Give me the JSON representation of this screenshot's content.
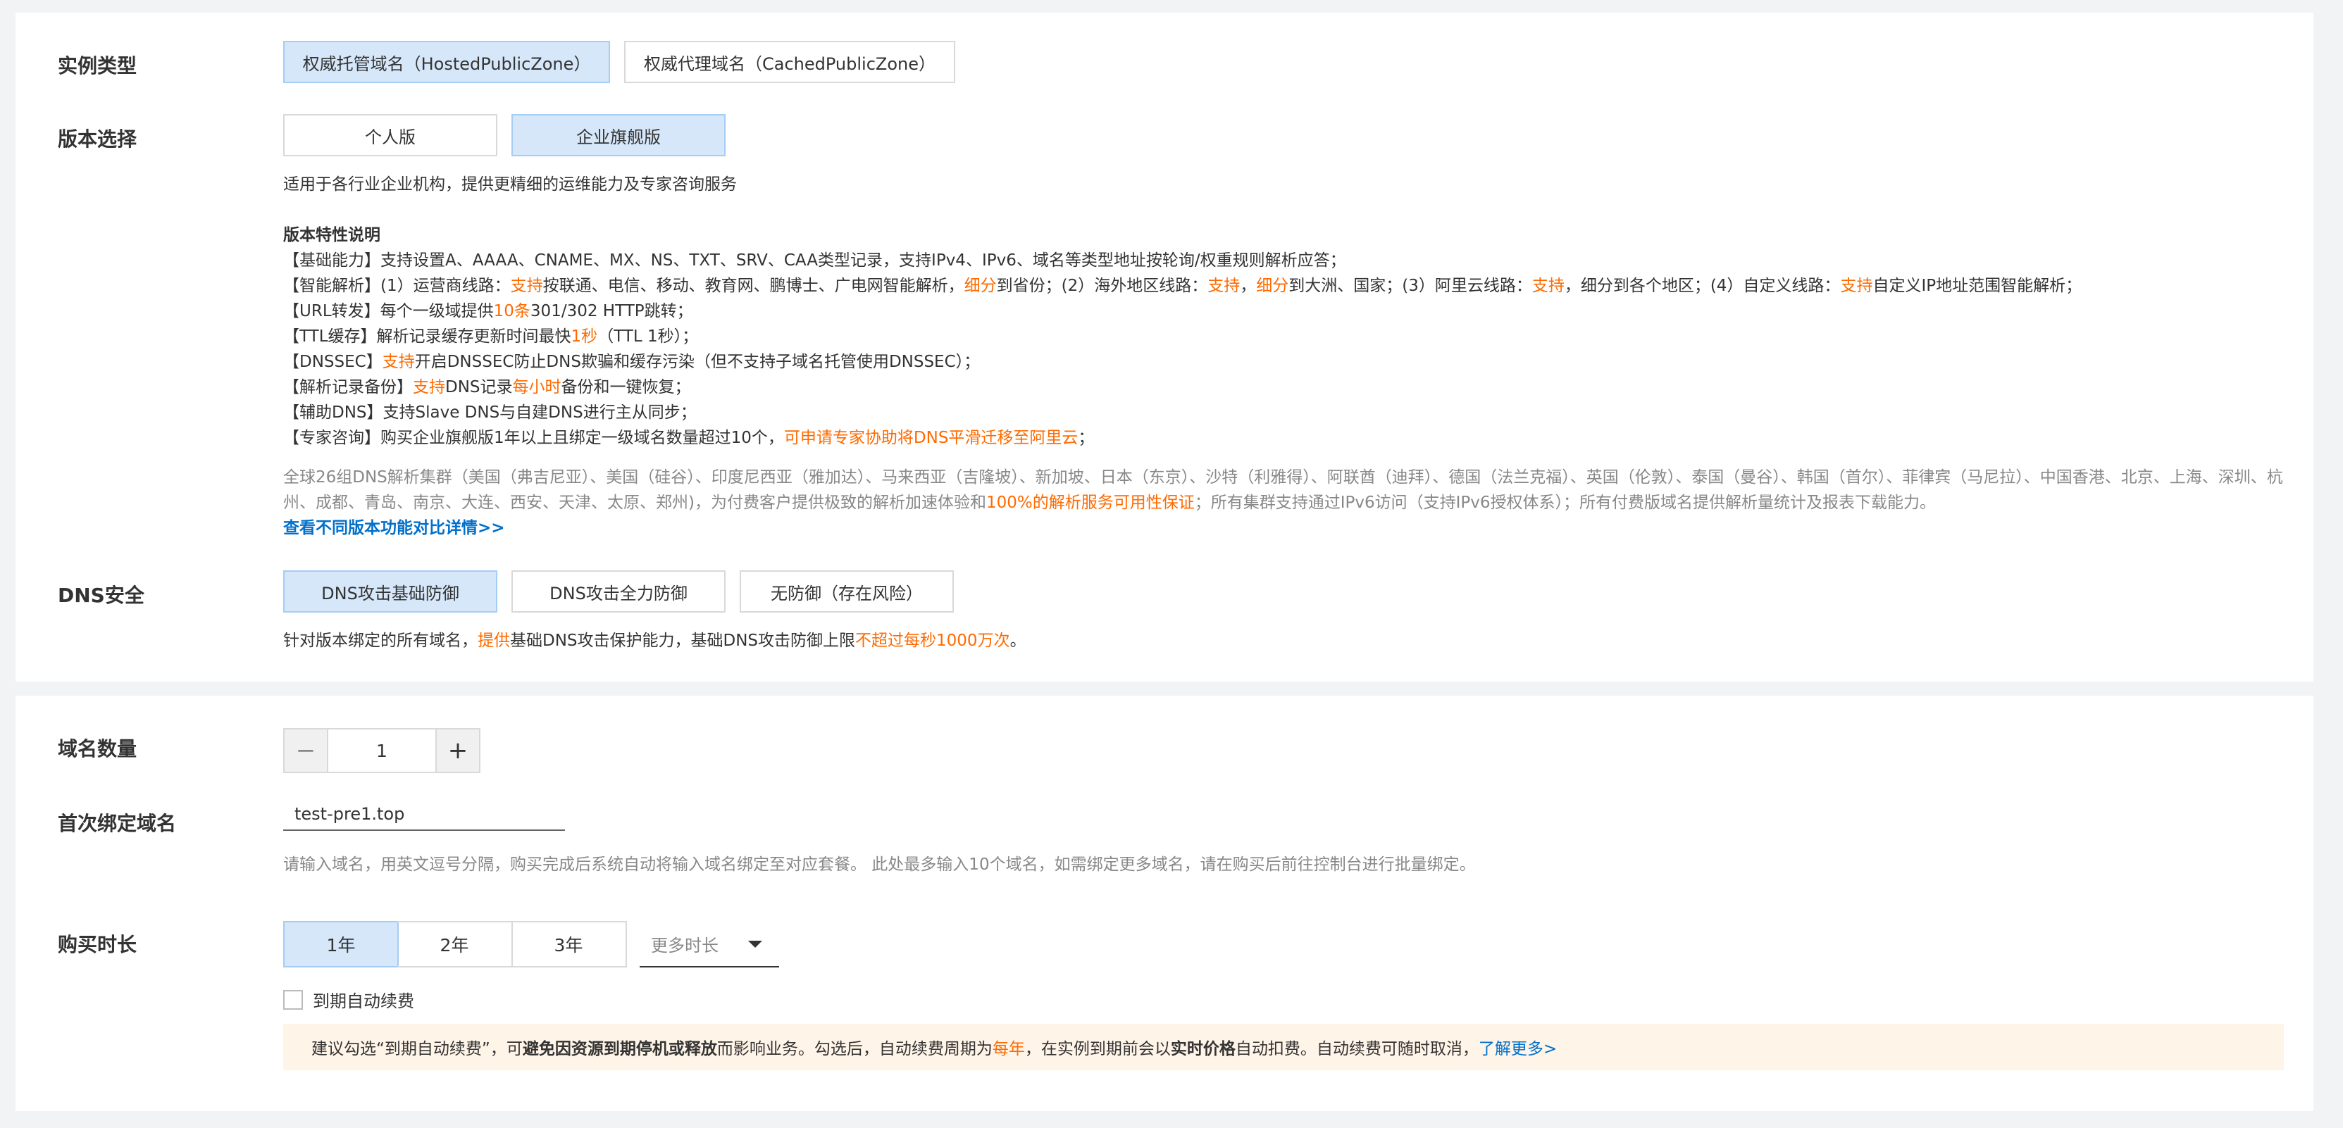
{
  "instance_type": {
    "label": "实例类型",
    "options": [
      "权威托管域名（HostedPublicZone）",
      "权威代理域名（CachedPublicZone）"
    ],
    "selected": 0
  },
  "edition": {
    "label": "版本选择",
    "options": [
      "个人版",
      "企业旗舰版"
    ],
    "selected": 1,
    "tagline": "适用于各行业企业机构，提供更精细的运维能力及专家咨询服务",
    "features_title": "版本特性说明",
    "features": {
      "basic": "【基础能力】支持设置A、AAAA、CNAME、MX、NS、TXT、SRV、CAA类型记录，支持IPv4、IPv6、域名等类型地址按轮询/权重规则解析应答；",
      "smart_a": "【智能解析】(1）运营商线路：",
      "smart_b": "支持",
      "smart_c": "按联通、电信、移动、教育网、鹏博士、广电网智能解析，",
      "smart_d": "细分",
      "smart_e": "到省份；(2）海外地区线路：",
      "smart_f": "支持",
      "smart_g": "，",
      "smart_h": "细分",
      "smart_i": "到大洲、国家；(3）阿里云线路：",
      "smart_j": "支持",
      "smart_k": "，细分到各个地区；(4）自定义线路：",
      "smart_l": "支持",
      "smart_m": "自定义IP地址范围智能解析；",
      "url_a": "【URL转发】每个一级域提供",
      "url_b": "10条",
      "url_c": "301/302 HTTP跳转；",
      "ttl_a": "【TTL缓存】解析记录缓存更新时间最快",
      "ttl_b": "1秒",
      "ttl_c": "（TTL 1秒）；",
      "dnssec_a": "【DNSSEC】",
      "dnssec_b": "支持",
      "dnssec_c": "开启DNSSEC防止DNS欺骗和缓存污染（但不支持子域名托管使用DNSSEC）；",
      "backup_a": "【解析记录备份】",
      "backup_b": "支持",
      "backup_c": "DNS记录",
      "backup_d": "每小时",
      "backup_e": "备份和一键恢复；",
      "aux": "【辅助DNS】支持Slave DNS与自建DNS进行主从同步；",
      "expert_a": "【专家咨询】购买企业旗舰版1年以上且绑定一级域名数量超过10个，",
      "expert_b": "可申请专家协助将DNS平滑迁移至阿里云",
      "expert_c": "；"
    },
    "coverage_a": "全球26组DNS解析集群（美国（弗吉尼亚）、美国（硅谷）、印度尼西亚（雅加达）、马来西亚（吉隆坡）、新加坡、日本（东京）、沙特（利雅得）、阿联酋（迪拜）、德国（法兰克福）、英国（伦敦）、泰国（曼谷）、韩国（首尔）、菲律宾（马尼拉）、中国香港、北京、上海、深圳、杭州、成都、青岛、南京、大连、西安、天津、太原、郑州)，为付费客户提供极致的解析加速体验和",
    "coverage_b": "100%的解析服务可用性保证",
    "coverage_c": "；所有集群支持通过IPv6访问（支持IPv6授权体系）；所有付费版域名提供解析量统计及报表下载能力。",
    "compare_link": "查看不同版本功能对比详情>>"
  },
  "dns_security": {
    "label": "DNS安全",
    "options": [
      "DNS攻击基础防御",
      "DNS攻击全力防御",
      "无防御（存在风险）"
    ],
    "selected": 0,
    "desc_a": "针对版本绑定的所有域名，",
    "desc_b": "提供",
    "desc_c": "基础DNS攻击保护能力，基础DNS攻击防御上限",
    "desc_d": "不超过每秒1000万次",
    "desc_e": "。"
  },
  "domain_count": {
    "label": "域名数量",
    "value": "1",
    "minus": "−",
    "plus": "+"
  },
  "first_domain": {
    "label": "首次绑定域名",
    "value": "test-pre1.top",
    "hint": "请输入域名，用英文逗号分隔，购买完成后系统自动将输入域名绑定至对应套餐。 此处最多输入10个域名，如需绑定更多域名，请在购买后前往控制台进行批量绑定。"
  },
  "duration": {
    "label": "购买时长",
    "options": [
      "1年",
      "2年",
      "3年"
    ],
    "selected": 0,
    "more": "更多时长",
    "auto_renew_label": "到期自动续费",
    "auto_renew_checked": false,
    "notice_a": "建议勾选“到期自动续费”，可",
    "notice_b": "避免因资源到期停机或释放",
    "notice_c": "而影响业务。勾选后，自动续费周期为 ",
    "notice_d": "每年",
    "notice_e": "，在实例到期前会以",
    "notice_f": "实时价格",
    "notice_g": "自动扣费。自动续费可随时取消，",
    "notice_link": "了解更多>"
  }
}
